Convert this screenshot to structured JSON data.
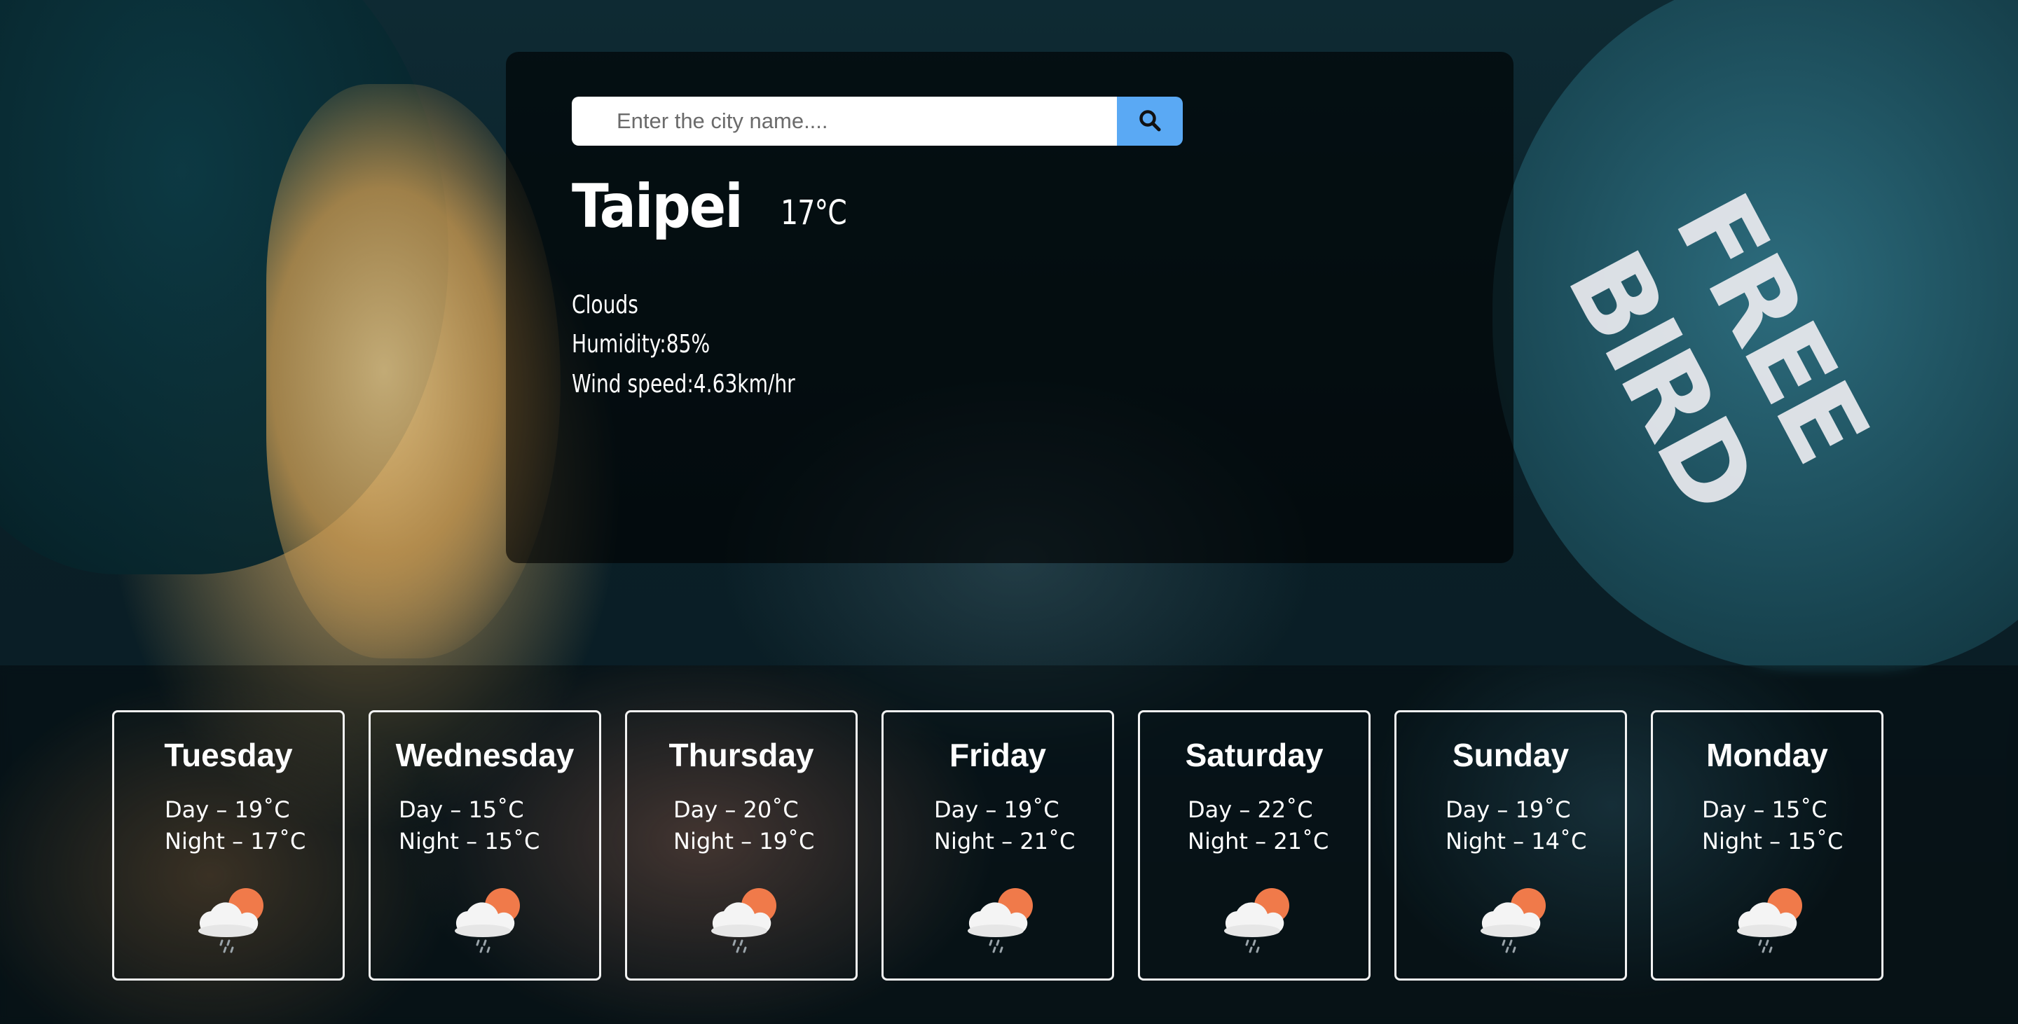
{
  "search": {
    "placeholder": "Enter the city name....",
    "button_icon": "search-icon"
  },
  "current": {
    "city": "Taipei",
    "temperature": "17°C",
    "description": "Clouds",
    "humidity": "Humidity:85%",
    "wind_speed": "Wind speed:4.63km/hr"
  },
  "background": {
    "photo_text": "FREE BIRD"
  },
  "forecast": [
    {
      "day": "Tuesday",
      "day_temp": "Day – 19˚C",
      "night_temp": "Night – 17˚C",
      "icon": "cloud-sun-rain-icon"
    },
    {
      "day": "Wednesday",
      "day_temp": "Day – 15˚C",
      "night_temp": "Night – 15˚C",
      "icon": "cloud-sun-rain-icon"
    },
    {
      "day": "Thursday",
      "day_temp": "Day – 20˚C",
      "night_temp": "Night – 19˚C",
      "icon": "cloud-sun-rain-icon"
    },
    {
      "day": "Friday",
      "day_temp": "Day – 19˚C",
      "night_temp": "Night – 21˚C",
      "icon": "cloud-sun-rain-icon"
    },
    {
      "day": "Saturday",
      "day_temp": "Day – 22˚C",
      "night_temp": "Night – 21˚C",
      "icon": "cloud-sun-rain-icon"
    },
    {
      "day": "Sunday",
      "day_temp": "Day – 19˚C",
      "night_temp": "Night – 14˚C",
      "icon": "cloud-sun-rain-icon"
    },
    {
      "day": "Monday",
      "day_temp": "Day – 15˚C",
      "night_temp": "Night – 15˚C",
      "icon": "cloud-sun-rain-icon"
    }
  ],
  "colors": {
    "search_button": "#5aa9f4",
    "sun": "#f07a4a",
    "card_border": "#f2f2f2"
  }
}
